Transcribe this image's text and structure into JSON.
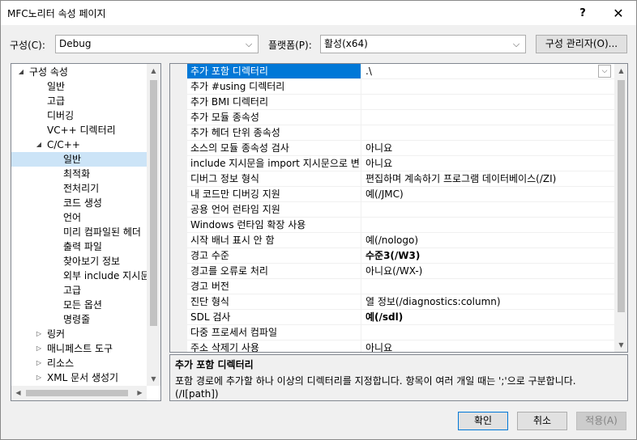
{
  "window": {
    "title": "MFC노리터 속성 페이지",
    "help": "?",
    "close": "✕"
  },
  "config_bar": {
    "config_label": "구성(C):",
    "config_value": "Debug",
    "platform_label": "플랫폼(P):",
    "platform_value": "활성(x64)",
    "config_manager": "구성 관리자(O)..."
  },
  "tree": {
    "items": [
      {
        "label": "구성 속성",
        "arrow": "◢",
        "level": 1,
        "selected": false
      },
      {
        "label": "일반",
        "arrow": "",
        "level": 2,
        "selected": false
      },
      {
        "label": "고급",
        "arrow": "",
        "level": 2,
        "selected": false
      },
      {
        "label": "디버깅",
        "arrow": "",
        "level": 2,
        "selected": false
      },
      {
        "label": "VC++ 디렉터리",
        "arrow": "",
        "level": 2,
        "selected": false
      },
      {
        "label": "C/C++",
        "arrow": "◢",
        "level": 2,
        "selected": false
      },
      {
        "label": "일반",
        "arrow": "",
        "level": 3,
        "selected": true
      },
      {
        "label": "최적화",
        "arrow": "",
        "level": 3,
        "selected": false
      },
      {
        "label": "전처리기",
        "arrow": "",
        "level": 3,
        "selected": false
      },
      {
        "label": "코드 생성",
        "arrow": "",
        "level": 3,
        "selected": false
      },
      {
        "label": "언어",
        "arrow": "",
        "level": 3,
        "selected": false
      },
      {
        "label": "미리 컴파일된 헤더",
        "arrow": "",
        "level": 3,
        "selected": false
      },
      {
        "label": "출력 파일",
        "arrow": "",
        "level": 3,
        "selected": false
      },
      {
        "label": "찾아보기 정보",
        "arrow": "",
        "level": 3,
        "selected": false
      },
      {
        "label": "외부 include 지시문",
        "arrow": "",
        "level": 3,
        "selected": false
      },
      {
        "label": "고급",
        "arrow": "",
        "level": 3,
        "selected": false
      },
      {
        "label": "모든 옵션",
        "arrow": "",
        "level": 3,
        "selected": false
      },
      {
        "label": "명령줄",
        "arrow": "",
        "level": 3,
        "selected": false
      },
      {
        "label": "링커",
        "arrow": "▷",
        "level": 2,
        "selected": false
      },
      {
        "label": "매니페스트 도구",
        "arrow": "▷",
        "level": 2,
        "selected": false
      },
      {
        "label": "리소스",
        "arrow": "▷",
        "level": 2,
        "selected": false
      },
      {
        "label": "XML 문서 생성기",
        "arrow": "▷",
        "level": 2,
        "selected": false
      }
    ]
  },
  "grid": {
    "rows": [
      {
        "name": "추가 포함 디렉터리",
        "value": ".\\",
        "bold": false,
        "selected": true
      },
      {
        "name": "추가 #using 디렉터리",
        "value": "",
        "bold": false,
        "selected": false
      },
      {
        "name": "추가 BMI 디렉터리",
        "value": "",
        "bold": false,
        "selected": false
      },
      {
        "name": "추가 모듈 종속성",
        "value": "",
        "bold": false,
        "selected": false
      },
      {
        "name": "추가 헤더 단위 종속성",
        "value": "",
        "bold": false,
        "selected": false
      },
      {
        "name": "소스의 모듈 종속성 검사",
        "value": "아니요",
        "bold": false,
        "selected": false
      },
      {
        "name": "include 지시문을 import 지시문으로 변",
        "value": "아니요",
        "bold": false,
        "selected": false
      },
      {
        "name": "디버그 정보 형식",
        "value": "편집하며 계속하기 프로그램 데이터베이스(/ZI)",
        "bold": false,
        "selected": false
      },
      {
        "name": "내 코드만 디버깅 지원",
        "value": "예(/JMC)",
        "bold": false,
        "selected": false
      },
      {
        "name": "공용 언어 런타임 지원",
        "value": "",
        "bold": false,
        "selected": false
      },
      {
        "name": "Windows 런타임 확장 사용",
        "value": "",
        "bold": false,
        "selected": false
      },
      {
        "name": "시작 배너 표시 안 함",
        "value": "예(/nologo)",
        "bold": false,
        "selected": false
      },
      {
        "name": "경고 수준",
        "value": "수준3(/W3)",
        "bold": true,
        "selected": false
      },
      {
        "name": "경고를 오류로 처리",
        "value": "아니요(/WX-)",
        "bold": false,
        "selected": false
      },
      {
        "name": "경고 버전",
        "value": "",
        "bold": false,
        "selected": false
      },
      {
        "name": "진단 형식",
        "value": "열 정보(/diagnostics:column)",
        "bold": false,
        "selected": false
      },
      {
        "name": "SDL 검사",
        "value": "예(/sdl)",
        "bold": true,
        "selected": false
      },
      {
        "name": "다중 프로세서 컴파일",
        "value": "",
        "bold": false,
        "selected": false
      },
      {
        "name": "주소 삭제기 사용",
        "value": "아니요",
        "bold": false,
        "selected": false
      }
    ]
  },
  "description": {
    "title": "추가 포함 디렉터리",
    "text": "포함 경로에 추가할 하나 이상의 디렉터리를 지정합니다. 항목이 여러 개일 때는 ';'으로 구분합니다.",
    "switch": "(/I[path])"
  },
  "buttons": {
    "ok": "확인",
    "cancel": "취소",
    "apply": "적용(A)"
  }
}
